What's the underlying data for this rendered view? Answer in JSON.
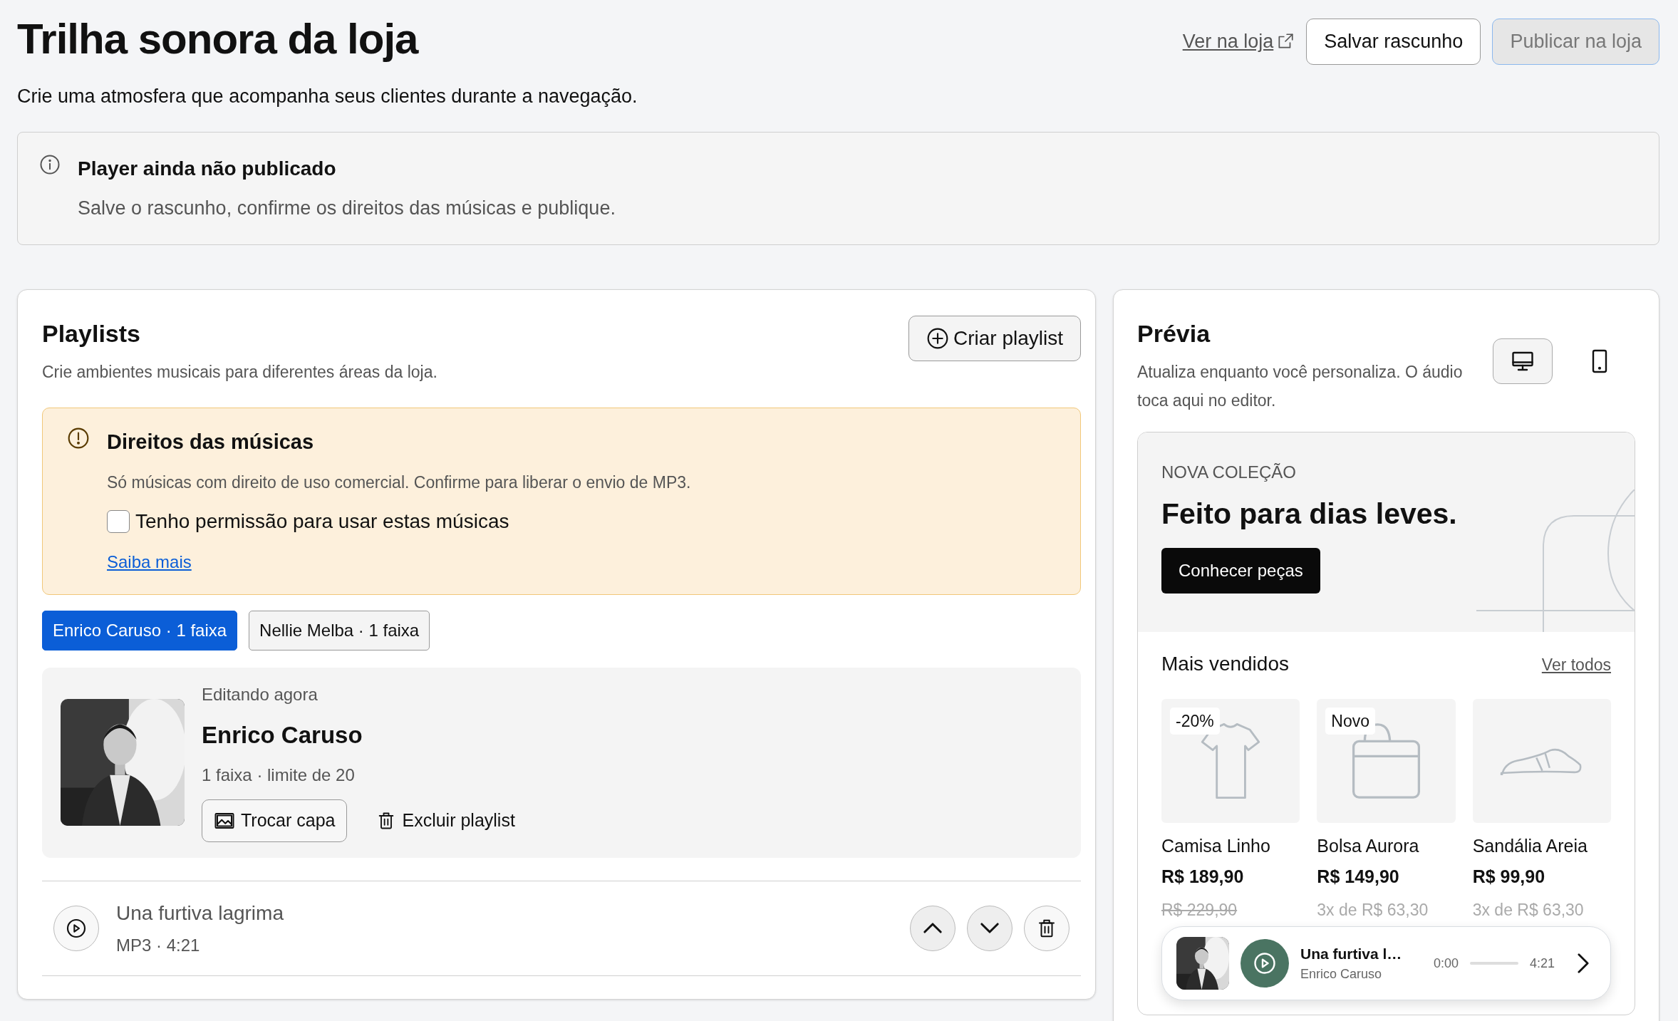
{
  "header": {
    "title": "Trilha sonora da loja",
    "subtitle": "Crie uma atmosfera que acompanha seus clientes durante a navegação.",
    "actions": [
      {
        "kind": "link",
        "label": "Ver na loja"
      },
      {
        "kind": "button",
        "label": "Salvar rascunho",
        "disabled": false
      },
      {
        "kind": "button",
        "label": "Publicar na loja",
        "disabled": true
      }
    ]
  },
  "notice": {
    "title": "Player ainda não publicado",
    "text": "Salve o rascunho, confirme os direitos das músicas e publique."
  },
  "playlists_panel": {
    "title": "Playlists",
    "subtitle": "Crie ambientes musicais para diferentes áreas da loja.",
    "create_button": "Criar playlist",
    "rights_alert": {
      "title": "Direitos das músicas",
      "text": "Só músicas com direito de uso comercial. Confirme para liberar o envio de MP3.",
      "checkbox": {
        "label": "Tenho permissão para usar estas músicas",
        "checked": false
      },
      "link": "Saiba mais"
    },
    "chips": [
      {
        "label": "Enrico Caruso · 1 faixa",
        "selected": true
      },
      {
        "label": "Nellie Melba · 1 faixa",
        "selected": false
      }
    ],
    "editor": {
      "eyebrow": "Editando agora",
      "name": "Enrico Caruso",
      "meta": "1 faixa · limite de 20",
      "buttons": [
        {
          "kind": "cover",
          "label": "Trocar capa"
        },
        {
          "kind": "delete",
          "label": "Excluir playlist"
        }
      ]
    },
    "tracks": [
      {
        "title": "Una furtiva lagrima",
        "meta": "MP3 · 4:21"
      }
    ]
  },
  "preview": {
    "title": "Prévia",
    "text": "Atualiza enquanto você personaliza. O áudio toca aqui no editor.",
    "devices": [
      {
        "kind": "desktop",
        "selected": true
      },
      {
        "kind": "mobile",
        "selected": false
      }
    ],
    "hero": {
      "eyebrow": "NOVA COLEÇÃO",
      "title": "Feito para dias leves.",
      "button": "Conhecer peças"
    },
    "section": {
      "title": "Mais vendidos",
      "link": "Ver todos"
    },
    "products": [
      {
        "kind": "shirt",
        "badge": "-20%",
        "name": "Camisa Linho",
        "price": "R$ 189,90",
        "old_price": "R$ 229,90"
      },
      {
        "kind": "bag",
        "badge": "Novo",
        "name": "Bolsa Aurora",
        "price": "R$ 149,90",
        "installments": "3x de R$ 63,30"
      },
      {
        "kind": "sandal",
        "name": "Sandália Areia",
        "price": "R$ 99,90",
        "installments": "3x de R$ 63,30"
      }
    ],
    "mini_player": {
      "title": "Una furtiva l…",
      "artist": "Enrico Caruso",
      "elapsed": "0:00",
      "duration": "4:21"
    }
  }
}
